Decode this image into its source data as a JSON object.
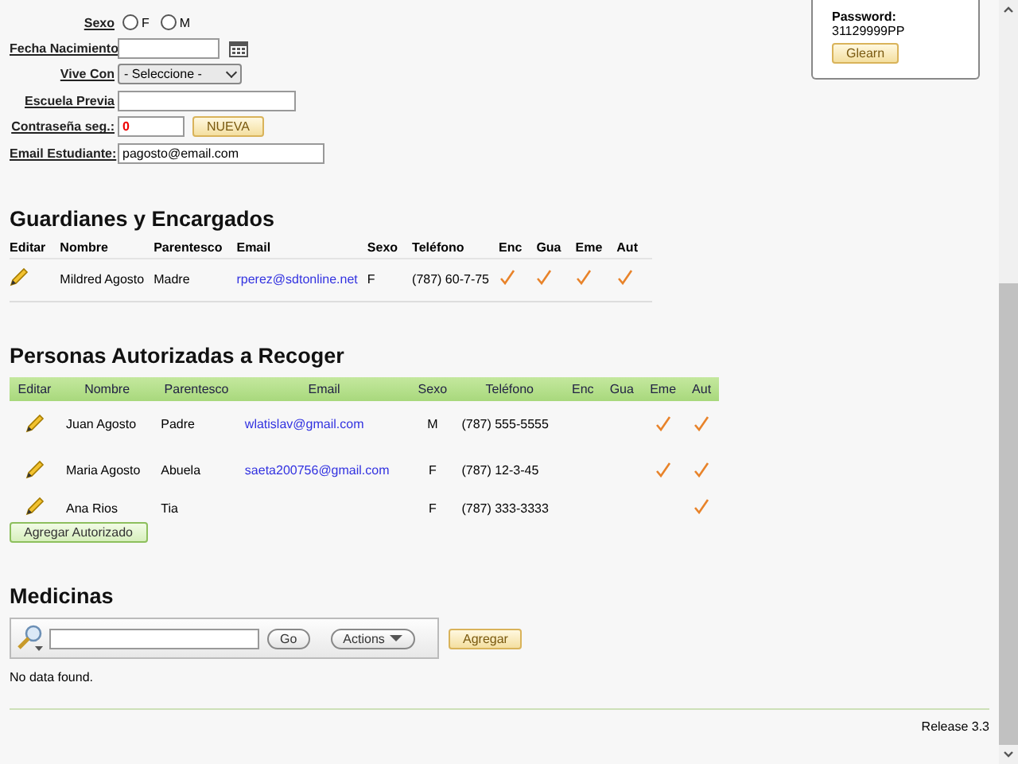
{
  "form": {
    "sexo": {
      "label": "Sexo",
      "options": [
        {
          "label": "F",
          "selected": false
        },
        {
          "label": "M",
          "selected": false
        }
      ]
    },
    "fecha": {
      "label": "Fecha Nacimiento"
    },
    "vive_con": {
      "label": "Vive Con",
      "value": "- Seleccione -"
    },
    "escuela": {
      "label": "Escuela Previa"
    },
    "contrasena": {
      "label": "Contraseña seg.:",
      "value": "0",
      "button": "NUEVA"
    },
    "email": {
      "label": "Email Estudiante:",
      "value": "pagosto@email.com"
    }
  },
  "account_box": {
    "password_label": "Password:",
    "password": "31129999PP",
    "button": "Glearn"
  },
  "guardianes": {
    "title": "Guardianes y Encargados",
    "columns": [
      "Editar",
      "Nombre",
      "Parentesco",
      "Email",
      "Sexo",
      "Teléfono",
      "Enc",
      "Gua",
      "Eme",
      "Aut"
    ],
    "rows": [
      {
        "nombre": "Mildred Agosto",
        "parentesco": "Madre",
        "email": "rperez@sdtonline.net",
        "sexo": "F",
        "telefono": "(787) 60-7-75",
        "enc": true,
        "gua": true,
        "eme": true,
        "aut": true
      }
    ]
  },
  "autorizadas": {
    "title": "Personas Autorizadas a Recoger",
    "columns": [
      "Editar",
      "Nombre",
      "Parentesco",
      "Email",
      "Sexo",
      "Teléfono",
      "Enc",
      "Gua",
      "Eme",
      "Aut"
    ],
    "rows": [
      {
        "nombre": "Juan Agosto",
        "parentesco": "Padre",
        "email": "wlatislav@gmail.com",
        "sexo": "M",
        "telefono": "(787) 555-5555",
        "enc": false,
        "gua": false,
        "eme": true,
        "aut": true
      },
      {
        "nombre": "Maria Agosto",
        "parentesco": "Abuela",
        "email": "saeta200756@gmail.com",
        "sexo": "F",
        "telefono": "(787) 12-3-45",
        "enc": false,
        "gua": false,
        "eme": true,
        "aut": true
      },
      {
        "nombre": "Ana Rios",
        "parentesco": "Tia",
        "sexo": "F",
        "telefono": "(787) 333-3333",
        "enc": false,
        "gua": false,
        "eme": false,
        "aut": true
      }
    ],
    "button": "Agregar Autorizado"
  },
  "medicinas": {
    "title": "Medicinas",
    "go": "Go",
    "actions": "Actions",
    "agregar": "Agregar",
    "empty": "No data found."
  },
  "footer": {
    "release": "Release 3.3"
  }
}
